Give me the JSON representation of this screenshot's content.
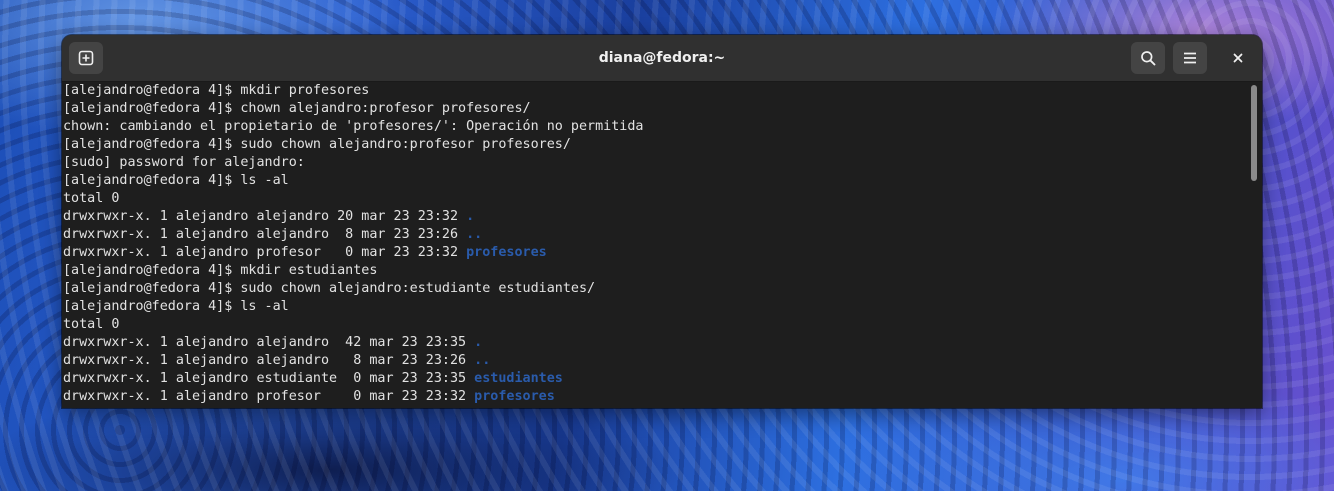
{
  "window": {
    "title": "diana@fedora:~"
  },
  "header": {
    "new_tab_icon": "new-tab-icon",
    "search_icon": "search-icon",
    "menu_icon": "hamburger-menu-icon",
    "close_icon": "close-icon"
  },
  "colors": {
    "directory": "#2a5bab",
    "text": "#e2e2e2",
    "background": "#1e1e1e",
    "headerbar": "#303030"
  },
  "terminal": {
    "lines": [
      {
        "text": "[alejandro@fedora 4]$ mkdir profesores",
        "dir": ""
      },
      {
        "text": "[alejandro@fedora 4]$ chown alejandro:profesor profesores/",
        "dir": ""
      },
      {
        "text": "chown: cambiando el propietario de 'profesores/': Operación no permitida",
        "dir": ""
      },
      {
        "text": "[alejandro@fedora 4]$ sudo chown alejandro:profesor profesores/",
        "dir": ""
      },
      {
        "text": "[sudo] password for alejandro:",
        "dir": ""
      },
      {
        "text": "[alejandro@fedora 4]$ ls -al",
        "dir": ""
      },
      {
        "text": "total 0",
        "dir": ""
      },
      {
        "text": "drwxrwxr-x. 1 alejandro alejandro 20 mar 23 23:32 ",
        "dir": "."
      },
      {
        "text": "drwxrwxr-x. 1 alejandro alejandro  8 mar 23 23:26 ",
        "dir": ".."
      },
      {
        "text": "drwxrwxr-x. 1 alejandro profesor   0 mar 23 23:32 ",
        "dir": "profesores"
      },
      {
        "text": "[alejandro@fedora 4]$ mkdir estudiantes",
        "dir": ""
      },
      {
        "text": "[alejandro@fedora 4]$ sudo chown alejandro:estudiante estudiantes/",
        "dir": ""
      },
      {
        "text": "[alejandro@fedora 4]$ ls -al",
        "dir": ""
      },
      {
        "text": "total 0",
        "dir": ""
      },
      {
        "text": "drwxrwxr-x. 1 alejandro alejandro  42 mar 23 23:35 ",
        "dir": "."
      },
      {
        "text": "drwxrwxr-x. 1 alejandro alejandro   8 mar 23 23:26 ",
        "dir": ".."
      },
      {
        "text": "drwxrwxr-x. 1 alejandro estudiante  0 mar 23 23:35 ",
        "dir": "estudiantes"
      },
      {
        "text": "drwxrwxr-x. 1 alejandro profesor    0 mar 23 23:32 ",
        "dir": "profesores"
      }
    ]
  }
}
